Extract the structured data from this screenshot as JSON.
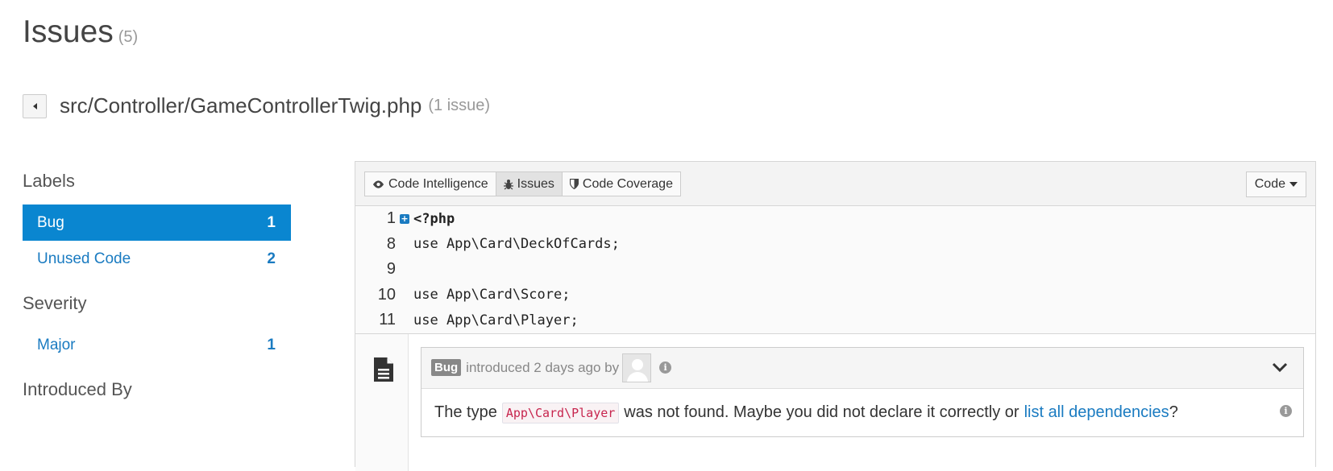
{
  "page": {
    "title": "Issues",
    "count": "(5)"
  },
  "file": {
    "path": "src/Controller/GameControllerTwig.php",
    "issue_count": "(1 issue)"
  },
  "sidebar": {
    "labels_heading": "Labels",
    "labels": [
      {
        "label": "Bug",
        "count": "1",
        "active": true
      },
      {
        "label": "Unused Code",
        "count": "2",
        "active": false
      }
    ],
    "severity_heading": "Severity",
    "severity": [
      {
        "label": "Major",
        "count": "1"
      }
    ],
    "introduced_heading": "Introduced By"
  },
  "toolbar": {
    "code_intelligence": "Code Intelligence",
    "issues": "Issues",
    "code_coverage": "Code Coverage",
    "code_dropdown": "Code"
  },
  "code": [
    {
      "line": "1",
      "text": "<?php"
    },
    {
      "line": "8",
      "text": "use App\\Card\\DeckOfCards;"
    },
    {
      "line": "9",
      "text": ""
    },
    {
      "line": "10",
      "text": "use App\\Card\\Score;"
    },
    {
      "line": "11",
      "text": "use App\\Card\\Player;"
    }
  ],
  "issue": {
    "badge": "Bug",
    "meta": "introduced 2 days ago by",
    "message_prefix": "The type",
    "type_name": "App\\Card\\Player",
    "message_middle": "was not found. Maybe you did not declare it correctly or",
    "link_text": "list all dependencies",
    "message_suffix": "?"
  },
  "colors": {
    "accent": "#0a86d0",
    "link": "#1a7bc1"
  },
  "icons": [
    "eye-icon",
    "bug-icon",
    "shield-icon",
    "caret-down-icon",
    "expand-icon",
    "file-text-icon",
    "info-icon",
    "chevron-down-icon",
    "avatar"
  ]
}
